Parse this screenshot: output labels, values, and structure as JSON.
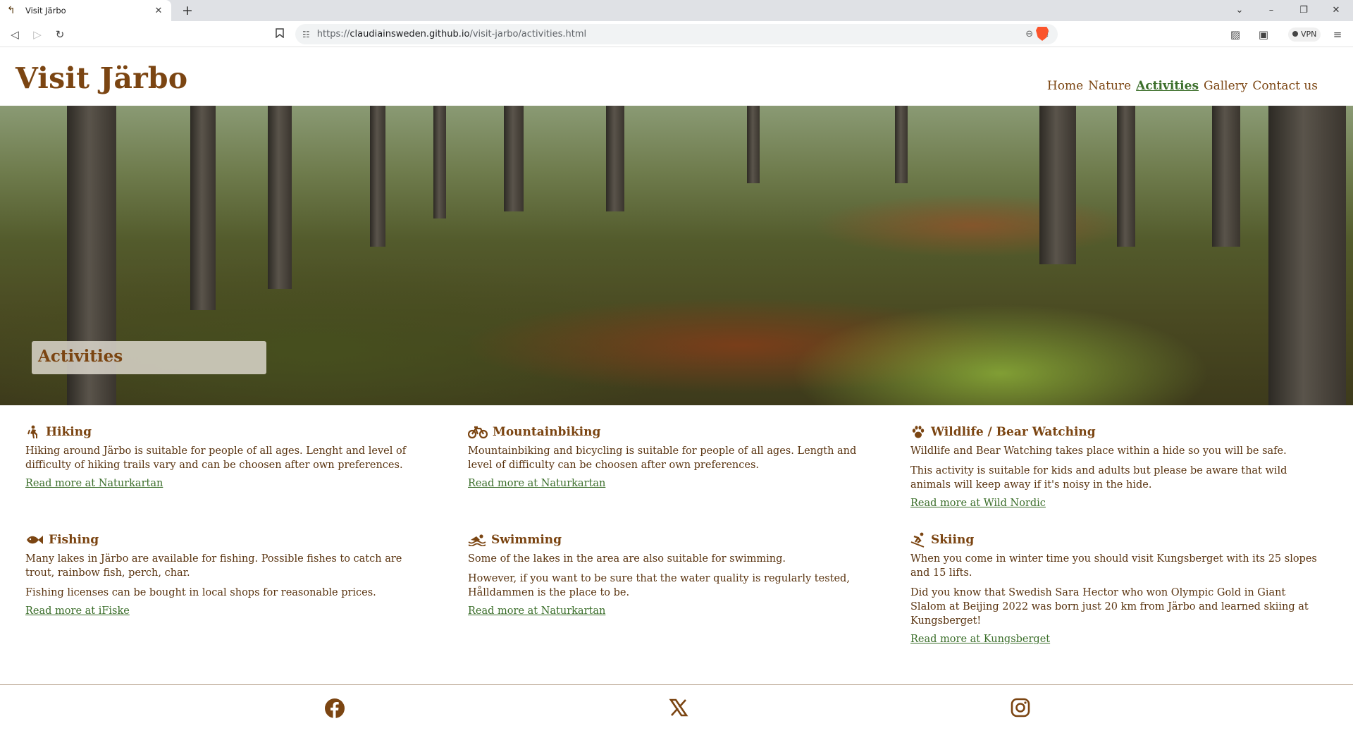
{
  "browser": {
    "tab_title": "Visit Järbo",
    "url_prefix": "https://",
    "url_host": "claudiainsweden.github.io",
    "url_path": "/visit-jarbo/activities.html",
    "vpn_label": "VPN"
  },
  "site": {
    "logo": "Visit Järbo",
    "nav": [
      "Home",
      "Nature",
      "Activities",
      "Gallery",
      "Contact us"
    ],
    "active_nav": "Activities"
  },
  "hero": {
    "heading": "Activities"
  },
  "activities": [
    {
      "icon": "hiking-icon",
      "title": "Hiking",
      "paragraphs": [
        "Hiking around Järbo is suitable for people of all ages. Lenght and level of difficulty of hiking trails vary and can be choosen after own preferences."
      ],
      "link": "Read more at Naturkartan"
    },
    {
      "icon": "bicycle-icon",
      "title": "Mountainbiking",
      "paragraphs": [
        "Mountainbiking and bicycling is suitable for people of all ages. Length and level of difficulty can be choosen after own preferences."
      ],
      "link": "Read more at Naturkartan"
    },
    {
      "icon": "paw-icon",
      "title": "Wildlife / Bear Watching",
      "paragraphs": [
        "Wildlife and Bear Watching takes place within a hide so you will be safe.",
        "This activity is suitable for kids and adults but please be aware that wild animals will keep away if it's noisy in the hide."
      ],
      "link": "Read more at Wild Nordic"
    },
    {
      "icon": "fish-icon",
      "title": "Fishing",
      "paragraphs": [
        "Many lakes in Järbo are available for fishing. Possible fishes to catch are trout, rainbow fish, perch, char.",
        "Fishing licenses can be bought in local shops for reasonable prices."
      ],
      "link": "Read more at iFiske"
    },
    {
      "icon": "swimmer-icon",
      "title": "Swimming",
      "paragraphs": [
        "Some of the lakes in the area are also suitable for swimming.",
        "However, if you want to be sure that the water quality is regularly tested, Hålldammen is the place to be."
      ],
      "link": "Read more at Naturkartan"
    },
    {
      "icon": "skiing-icon",
      "title": "Skiing",
      "paragraphs": [
        "When you come in winter time you should visit Kungsberget with its 25 slopes and 15 lifts.",
        "Did you know that Swedish Sara Hector who won Olympic Gold in Giant Slalom at Beijing 2022 was born just 20 km from Järbo and learned skiing at Kungsberget!"
      ],
      "link": "Read more at Kungsberget"
    }
  ],
  "footer": {
    "social": [
      "facebook-icon",
      "x-icon",
      "instagram-icon"
    ]
  },
  "colors": {
    "brand_brown": "#7b4512",
    "link_green": "#3b6e2a",
    "body_text": "#5a3410"
  }
}
